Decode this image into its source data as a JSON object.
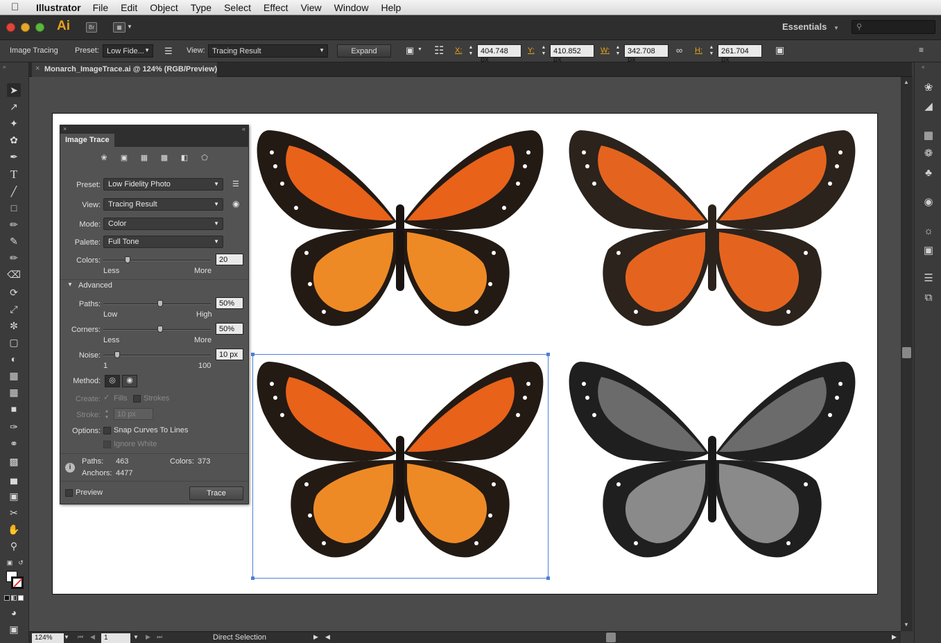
{
  "menubar": {
    "app": "Illustrator",
    "items": [
      "File",
      "Edit",
      "Object",
      "Type",
      "Select",
      "Effect",
      "View",
      "Window",
      "Help"
    ]
  },
  "appbar": {
    "logo": "Ai",
    "bridge": "Br",
    "workspace": "Essentials"
  },
  "control": {
    "label": "Image Tracing",
    "preset_label": "Preset:",
    "preset_value": "Low Fide...",
    "view_label": "View:",
    "view_value": "Tracing Result",
    "expand": "Expand",
    "x_label": "X:",
    "x_value": "404.748 px",
    "y_label": "Y:",
    "y_value": "410.852 px",
    "w_label": "W:",
    "w_value": "342.708 px",
    "h_label": "H:",
    "h_value": "261.704 px"
  },
  "document": {
    "tab_title": "Monarch_ImageTrace.ai @ 124% (RGB/Preview)"
  },
  "panel": {
    "title": "Image Trace",
    "preset_label": "Preset:",
    "preset_value": "Low Fidelity Photo",
    "view_label": "View:",
    "view_value": "Tracing Result",
    "mode_label": "Mode:",
    "mode_value": "Color",
    "palette_label": "Palette:",
    "palette_value": "Full Tone",
    "colors_label": "Colors:",
    "colors_value": "20",
    "colors_min": "Less",
    "colors_max": "More",
    "advanced": "Advanced",
    "paths_label": "Paths:",
    "paths_value": "50%",
    "paths_min": "Low",
    "paths_max": "High",
    "corners_label": "Corners:",
    "corners_value": "50%",
    "corners_min": "Less",
    "corners_max": "More",
    "noise_label": "Noise:",
    "noise_value": "10 px",
    "noise_min": "1",
    "noise_max": "100",
    "method_label": "Method:",
    "create_label": "Create:",
    "fills": "Fills",
    "strokes": "Strokes",
    "stroke_label": "Stroke:",
    "stroke_value": "10 px",
    "options_label": "Options:",
    "snap": "Snap Curves To Lines",
    "ignore_white": "Ignore White",
    "paths_stat_label": "Paths:",
    "paths_stat": "463",
    "colors_stat_label": "Colors:",
    "colors_stat": "373",
    "anchors_stat_label": "Anchors:",
    "anchors_stat": "4477",
    "preview": "Preview",
    "trace": "Trace",
    "colors_slider": 0.2,
    "paths_slider": 0.5,
    "corners_slider": 0.5,
    "noise_slider": 0.1
  },
  "status": {
    "zoom": "124%",
    "page": "1",
    "tool": "Direct Selection"
  },
  "colors": {
    "accent": "#e8a21a",
    "selection": "#4f7fd8",
    "butterfly_orange": "#e8621a",
    "butterfly_dark": "#2a211b"
  }
}
